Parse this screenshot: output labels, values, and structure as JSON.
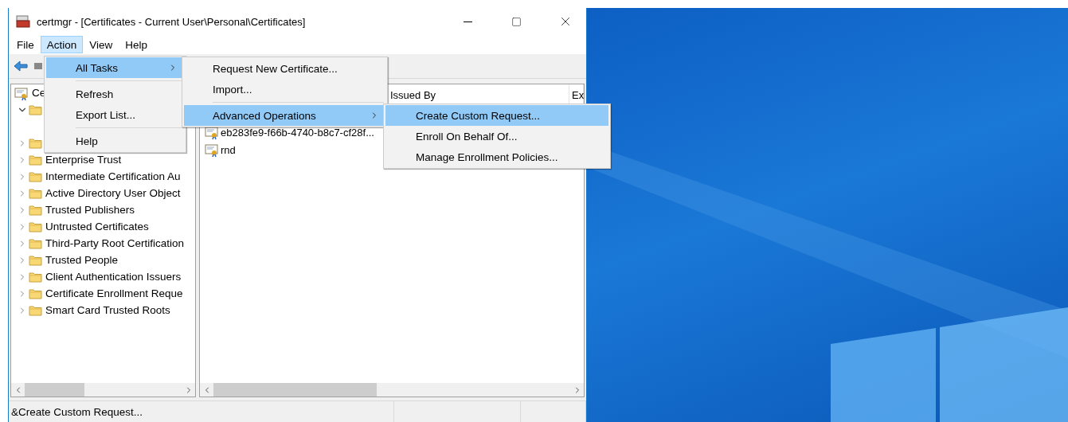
{
  "window": {
    "title": "certmgr - [Certificates - Current User\\Personal\\Certificates]"
  },
  "menu_bar": [
    {
      "label": "File",
      "selected": false
    },
    {
      "label": "Action",
      "selected": true
    },
    {
      "label": "View",
      "selected": false
    },
    {
      "label": "Help",
      "selected": false
    }
  ],
  "tree": {
    "root": {
      "label": "Ce"
    },
    "items": [
      {
        "expanded": true
      },
      {
        "expanded": false
      },
      {
        "label": "Enterprise Trust",
        "expanded": false
      },
      {
        "label": "Intermediate Certification Au",
        "expanded": false
      },
      {
        "label": "Active Directory User Object",
        "expanded": false
      },
      {
        "label": "Trusted Publishers",
        "expanded": false
      },
      {
        "label": "Untrusted Certificates",
        "expanded": false
      },
      {
        "label": "Third-Party Root Certification",
        "expanded": false
      },
      {
        "label": "Trusted People",
        "expanded": false
      },
      {
        "label": "Client Authentication Issuers",
        "expanded": false
      },
      {
        "label": "Certificate Enrollment Reque",
        "expanded": false
      },
      {
        "label": "Smart Card Trusted Roots",
        "expanded": false
      }
    ]
  },
  "list": {
    "columns": [
      {},
      {
        "label": "Issued By"
      },
      {
        "label": "Ex"
      }
    ],
    "rows": [
      {},
      {
        "name": "eb283fe9-f66b-4740-b8c7-cf28f..."
      },
      {
        "name": "rnd"
      }
    ]
  },
  "status_bar": {
    "text": "&Create Custom Request..."
  },
  "action_menu": [
    {
      "kind": "submenu",
      "label": "All Tasks",
      "selected": true
    },
    {
      "kind": "separator"
    },
    {
      "kind": "item",
      "label": "Refresh",
      "selected": false
    },
    {
      "kind": "item",
      "label": "Export List...",
      "selected": false
    },
    {
      "kind": "separator"
    },
    {
      "kind": "item",
      "label": "Help",
      "selected": false
    }
  ],
  "all_tasks_menu": [
    {
      "kind": "item",
      "label": "Request New Certificate...",
      "selected": false
    },
    {
      "kind": "item",
      "label": "Import...",
      "selected": false
    },
    {
      "kind": "separator"
    },
    {
      "kind": "submenu",
      "label": "Advanced Operations",
      "selected": true
    }
  ],
  "advanced_menu": [
    {
      "kind": "item",
      "label": "Create Custom Request...",
      "selected": true
    },
    {
      "kind": "item",
      "label": "Enroll On Behalf Of...",
      "selected": false
    },
    {
      "kind": "item",
      "label": "Manage Enrollment Policies...",
      "selected": false
    }
  ]
}
